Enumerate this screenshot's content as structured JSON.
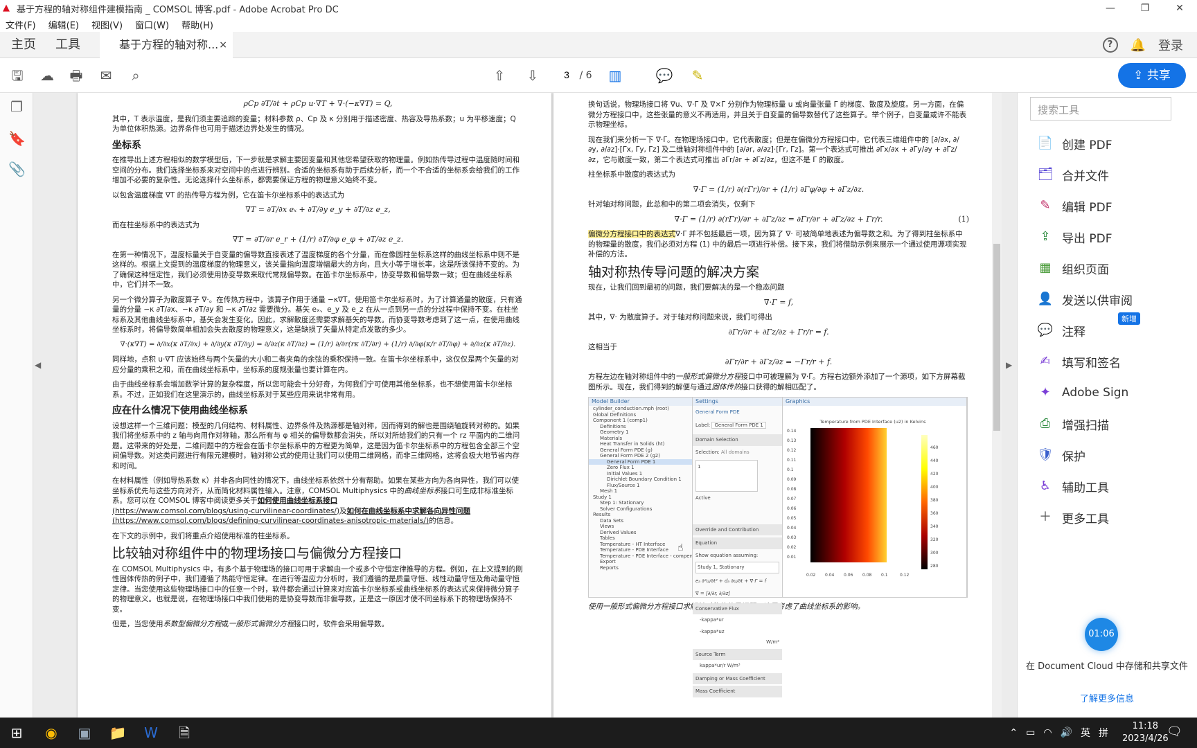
{
  "window": {
    "title": "基于方程的轴对称组件建模指南 _ COMSOL 博客.pdf - Adobe Acrobat Pro DC",
    "minimize": "—",
    "maximize": "❐",
    "close": "✕"
  },
  "menu": [
    "文件(F)",
    "编辑(E)",
    "视图(V)",
    "窗口(W)",
    "帮助(H)"
  ],
  "tabs": {
    "home": "主页",
    "tools": "工具",
    "doc": "基于方程的轴对称...",
    "close": "×",
    "login": "登录"
  },
  "page_nav": {
    "current": "3",
    "total": "/ 6"
  },
  "share": "共享",
  "search_tools": "搜索工具",
  "tools": [
    "创建 PDF",
    "合并文件",
    "编辑 PDF",
    "导出 PDF",
    "组织页面",
    "发送以供审阅",
    "注释",
    "填写和签名",
    "Adobe Sign",
    "增强扫描",
    "保护",
    "辅助工具",
    "更多工具"
  ],
  "new_badge": "新增",
  "timer": "01:06",
  "cloud_text": "在 Document Cloud 中存储和共享文件",
  "learn_more": "了解更多信息",
  "clock": {
    "time": "11:18",
    "date": "2023/4/26"
  },
  "tray": {
    "ime": "英",
    "grid": "拼"
  },
  "page1": {
    "eq0": "ρCp ∂T/∂t + ρCp u·∇T + ∇·(−κ∇T) = Q,",
    "p1": "其中，T 表示温度，是我们须主要追踪的变量；材料参数 ρ、Cp 及 κ 分别用于描述密度、热容及导热系数；u 为平移速度；Q 为单位体积热源。边界条件也可用于描述边界处发生的情况。",
    "h_coord": "坐标系",
    "p2": "在推导出上述方程相似的数学模型后，下一步就是求解主要因变量和其他您希望获取的物理量。例如热传导过程中温度随时间和空间的分布。我们选择坐标系来对空间中的点进行辨别。合适的坐标系有助于后续分析，而一个不合适的坐标系会给我们的工作增加不必要的复杂性。无论选择什么坐标系，都需要保证方程的物理意义始终不变。",
    "p3": "以包含温度梯度 ∇T 的热传导方程为例，它在笛卡尔坐标系中的表达式为",
    "eq1": "∇T = ∂T/∂x eₓ + ∂T/∂y e_y + ∂T/∂z e_z,",
    "p4": "而在柱坐标系中的表达式为",
    "eq2": "∇T = ∂T/∂r e_r + (1/r) ∂T/∂φ e_φ + ∂T/∂z e_z.",
    "p5": "在第一种情况下，温度标量关于自变量的偏导数直接表述了温度梯度的各个分量，而在像圆柱坐标系这样的曲线坐标系中则不是这样的。根据上文提到的温度梯度的物理意义，该关量指向温度增幅最大的方向，且大小等于增长率，这是所该保持不变的。为了确保这种恒定性，我们必须使用协变导数来取代常规偏导数。在笛卡尔坐标系中，协变导数和偏导数一致；但在曲线坐标系中，它们并不一致。",
    "p6": "另一个微分算子为散度算子 ∇·。在传热方程中，该算子作用于通量 −κ∇T。使用笛卡尔坐标系时，为了计算通量的散度，只有通量的分量 −κ ∂T/∂x、−κ ∂T/∂y 和 −κ ∂T/∂z 需要微分。基矢 eₓ、e_y 及 e_z 在从一点到另一点的分过程中保持不变。在柱坐标系及其他曲线坐标系中，基矢会发生变化。因此，求解散度还需要求解基矢的导数。而协变导数考虑到了这一点，在使用曲线坐标系时，将偏导数简单相加会失去散度的物理意义，这是缺损了矢量从特定点发散的多少。",
    "eq3": "∇·(κ∇T) = ∂/∂x(κ ∂T/∂x) + ∂/∂y(κ ∂T/∂y) = ∂/∂z(κ ∂T/∂z) = (1/r) ∂/∂r(rκ ∂T/∂r) + (1/r) ∂/∂φ(κ/r ∂T/∂φ) + ∂/∂z(κ ∂T/∂z).",
    "p7": "同样地，点积 u·∇T 应该始终与两个矢量的大小和二者夹角的余弦的乘积保持一致。在笛卡尔坐标系中，这仅仅是两个矢量的对应分量的乘积之和，而在曲线坐标系中，坐标系的度规张量也要计算在内。",
    "p8": "由于曲线坐标系会增加数学计算的复杂程度，所以您可能会十分好奇，为何我们宁可使用其他坐标系，也不想使用笛卡尔坐标系。不过，正如我们在这里演示的，曲线坐标系对于某些应用来说非常有用。",
    "h_when": "应在什么情况下使用曲线坐标系",
    "p9": "设想这样一个三维问题：模型的几何结构、材料属性、边界条件及热源都是轴对称，因而得到的解也是围绕轴旋转对称的。如果我们将坐标系中的 z 轴与向用作对称轴，那么所有与 φ 相关的偏导数都会消失，所以对所给我们的只有一个 rz 平面内的二维问题。这带来的好处是，二维问题中的方程会在笛卡尔坐标系中的方程更为简单，这是因为笛卡尔坐标系中的方程包含全部三个空间偏导数。对这类问题进行有限元建模时，轴对称公式的使用让我们可以使用二维网格，而非三维网格，这将会极大地节省内存和时间。",
    "p10a": "在材料属性（例如导热系数 κ）并非各向同性的情况下，曲线坐标系依然十分有帮助。如果在某些方向为各向异性，我们可以使坐标系优先与这些方向对齐，从而简化材料属性输入。注意，COMSOL Multiphysics 中的",
    "p10i": "曲线坐标系",
    "p10b": "接口可生成非标准坐标系。您可以在 COMSOL 博客中阅读更多关于",
    "link1": "如何使用曲线坐标系接口",
    "url1": "(https://www.comsol.com/blogs/using-curvilinear-coordinates/)",
    "p10c": "及",
    "link2": "如何在曲线坐标系中求解各向异性问题",
    "url2": "(https://www.comsol.com/blogs/defining-curvilinear-coordinates-anisotropic-materials/)",
    "p10d": "的信息。",
    "p11": "在下文的示例中，我们将重点介绍使用标准的柱坐标系。",
    "h_compare": "比较轴对称组件中的物理场接口与偏微分方程接口",
    "p12": "在 COMSOL Multiphysics 中，有多个基于物理场的接口可用于求解由一个或多个守恒定律推导的方程。例如，在上文提到的刚性固体传热的例子中，我们遵循了热能守恒定律。在进行等温应力分析时，我们遵循的是质量守恒、线性动量守恒及角动量守恒定律。当您使用这些物理场接口中的任意一个时，软件都会通过计算来对应笛卡尔坐标系或曲线坐标系的表达式来保持微分算子的物理意义。也就是说，在物理场接口中我们使用的是协变导数而非偏导数，正是这一原因才使不同坐标系下的物理场保持不变。",
    "p13a": "但是，当您使用",
    "p13i1": "系数型偏微分方程",
    "p13b": "或",
    "p13i2": "一般形式偏微分方程",
    "p13c": "接口时，软件会采用偏导数。"
  },
  "page2": {
    "p1": "换句话说，物理场接口将 ∇u、∇·Γ 及 ∇×Γ 分别作为物理标量 u 或向量张量 Γ 的梯度、散度及旋度。另一方面，在偏微分方程接口中，这些张量的意义不再适用，并且关于自变量的偏导数替代了这些算子。举个例子，自变量或许不能表示物理坐标。",
    "p2": "现在我们来分析一下 ∇·Γ。在物理场接口中，它代表散度；但是在偏微分方程接口中，它代表三维组件中的 [∂/∂x, ∂/∂y, ∂/∂z]·[Γx, Γy, Γz] 及二维轴对称组件中的 [∂/∂r, ∂/∂z]·[Γr, Γz]。第一个表达式可推出 ∂Γx/∂x + ∂Γy/∂y + ∂Γz/∂z，它与散度一致，第二个表达式可推出 ∂Γr/∂r + ∂Γz/∂z，但这不是 Γ 的散度。",
    "p3": "柱坐标系中散度的表达式为",
    "eq1": "∇·Γ = (1/r) ∂(rΓr)/∂r + (1/r) ∂Γφ/∂φ + ∂Γz/∂z.",
    "p4": "针对轴对称问题，此总和中的第二项会消失，仅剩下",
    "eq2": "∇·Γ = (1/r) ∂(rΓr)/∂r + ∂Γz/∂z = ∂Γr/∂r + ∂Γz/∂z + Γr/r.",
    "eqnum": "(1)",
    "p5hl": "偏微分方程接口中的表达式",
    "p5": "∇·Γ 并不包括最后一项，因为算了 ∇· 可被简单地表述为偏导数之和。为了得到柱坐标系中的物理量的散度，我们必须对方程 (1) 中的最后一项进行补偿。接下来，我们将借助示例来展示一个通过使用源项实现补偿的方法。",
    "h_solve": "轴对称热传导问题的解决方案",
    "p6": "现在，让我们回到最初的问题，我们要解决的是一个稳态问题",
    "eq3": "∇·Γ = f,",
    "p7": "其中，∇· 为散度算子。对于轴对称问题来说，我们可得出",
    "eq4": "∂Γr/∂r + ∂Γz/∂z + Γr/r = f.",
    "p8": "这相当于",
    "eq5": "∂Γr/∂r + ∂Γz/∂z = −Γr/r + f.",
    "p9a": "方程左边在轴对称组件中的",
    "p9i": "一般形式偏微分方程",
    "p9b": "接口中可被理解为 ∇·Γ。方程右边额外添加了一个源项，如下方屏幕截图所示。现在，我们得到的解便与通过",
    "p9i2": "固体传热",
    "p9c": "接口获得的解相匹配了。",
    "caption": "使用一般形式偏微分方程接口求解轴对称热传导问题。这里考虑了曲线坐标系的影响。",
    "fig": {
      "mb": "Model Builder",
      "settings": "Settings",
      "graphics": "Graphics",
      "gf": "General Form PDE",
      "label": "Label:",
      "label_val": "General Form PDE 1",
      "domain_sel": "Domain Selection",
      "selection": "Selection:",
      "all_domains": "All domains",
      "active": "Active",
      "override": "Override and Contribution",
      "equation": "Equation",
      "show_eq": "Show equation assuming:",
      "study": "Study 1, Stationary",
      "eqtext": "eₐ ∂²u/∂t² + dₐ ∂u/∂t + ∇·Γ = f",
      "nabla": "∇ = [∂/∂r, ∂/∂z]",
      "conservative": "Conservative Flux",
      "g1": "-kappa*ur",
      "g2": "-kappa*uz",
      "unit": "W/m²",
      "source": "Source Term",
      "fval": "kappa*ur/r",
      "unit2": "W/m³",
      "damping": "Damping or Mass Coefficient",
      "mass": "Mass Coefficient",
      "plot_title": "Temperature from PDE Interface (u2) in Kelvins",
      "tree": [
        "cylinder_conduction.mph (root)",
        "Global Definitions",
        "Component 1 (comp1)",
        "Definitions",
        "Geometry 1",
        "Materials",
        "Heat Transfer in Solids (ht)",
        "General Form PDE (g)",
        "General Form PDE 2 (g2)",
        "General Form PDE 1",
        "Zero Flux 1",
        "Initial Values 1",
        "Dirichlet Boundary Condition 1",
        "Flux/Source 1",
        "Mesh 1",
        "Study 1",
        "Step 1: Stationary",
        "Solver Configurations",
        "Results",
        "Data Sets",
        "Views",
        "Derived Values",
        "Tables",
        "Temperature - HT Interface",
        "Temperature - PDE Interface",
        "Temperature - PDE Interface - compensation",
        "Export",
        "Reports"
      ],
      "yticks": [
        "0.14",
        "0.13",
        "0.12",
        "0.11",
        "0.1",
        "0.09",
        "0.08",
        "0.07",
        "0.06",
        "0.05",
        "0.04",
        "0.03",
        "0.02",
        "0.01"
      ],
      "xticks": [
        "0.02",
        "0.04",
        "0.06",
        "0.08",
        "0.1",
        "0.12"
      ],
      "cticks": [
        "460",
        "440",
        "420",
        "400",
        "380",
        "360",
        "340",
        "320",
        "300",
        "280"
      ]
    }
  },
  "colors": {
    "accent": "#1473e6",
    "pdf_red": "#d12b2b",
    "highlight": "#fff09a"
  }
}
